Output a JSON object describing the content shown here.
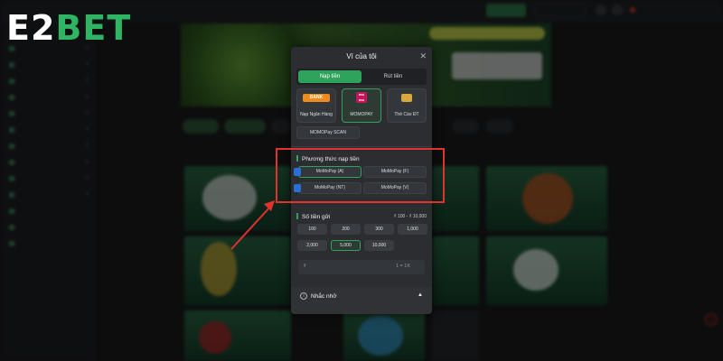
{
  "logo": {
    "part1": "E2",
    "part2": "BET"
  },
  "modal": {
    "title": "Ví của tôi",
    "tabs": [
      {
        "label": "Nạp tiền",
        "active": true
      },
      {
        "label": "Rút tiền",
        "active": false
      }
    ],
    "methods": [
      {
        "label": "Nạp Ngân Hàng",
        "icon_text": "BANK",
        "icon": "bank-icon"
      },
      {
        "label": "MOMOPAY",
        "icon_text": "mo mo",
        "icon": "momo-icon",
        "selected": true
      },
      {
        "label": "Thẻ Cào ĐT",
        "icon_text": "",
        "icon": "card-icon"
      }
    ],
    "momo_scan_label": "MOMOPay SCAN",
    "deposit_methods": {
      "title": "Phương thức nạp tiền",
      "options": [
        "MoMoPay (A)",
        "MoMoPay (F)",
        "MoMoPay (NT)",
        "MoMoPay (V)"
      ]
    },
    "amount": {
      "title": "Số tiền gửi",
      "range": "₫ 100 - ₫ 10,000",
      "presets": [
        "100",
        "200",
        "300",
        "1,000",
        "2,000",
        "5,000",
        "10,000"
      ],
      "selected": "5,000",
      "currency_symbol": "₫",
      "rate": "1 = 1K"
    },
    "reminder": {
      "label": "Nhắc nhở"
    }
  },
  "colors": {
    "accent": "#2fa35c",
    "logo_green": "#2fb463",
    "highlight": "#e0322e",
    "modal_bg": "#2b2d30"
  }
}
